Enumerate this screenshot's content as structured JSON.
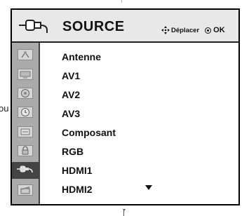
{
  "menu": {
    "title": "SOURCE",
    "hint_move_label": "Déplacer",
    "hint_ok_label": "OK",
    "side_text": "ou"
  },
  "sources": [
    {
      "label": "Antenne",
      "icon": "antenna-icon"
    },
    {
      "label": "AV1",
      "icon": "tv-icon"
    },
    {
      "label": "AV2",
      "icon": "disc-icon"
    },
    {
      "label": "AV3",
      "icon": "clock-icon"
    },
    {
      "label": "Composant",
      "icon": "component-icon"
    },
    {
      "label": "RGB",
      "icon": "lock-icon"
    },
    {
      "label": "HDMI1",
      "icon": "plug-icon"
    },
    {
      "label": "HDMI2",
      "icon": "clapper-icon"
    }
  ],
  "active_sidebar_index": 6,
  "colors": {
    "header_bg": "#e8e8e8",
    "sidebar_bg": "#ababab",
    "sidebar_active_bg": "#444444",
    "text": "#111111"
  }
}
